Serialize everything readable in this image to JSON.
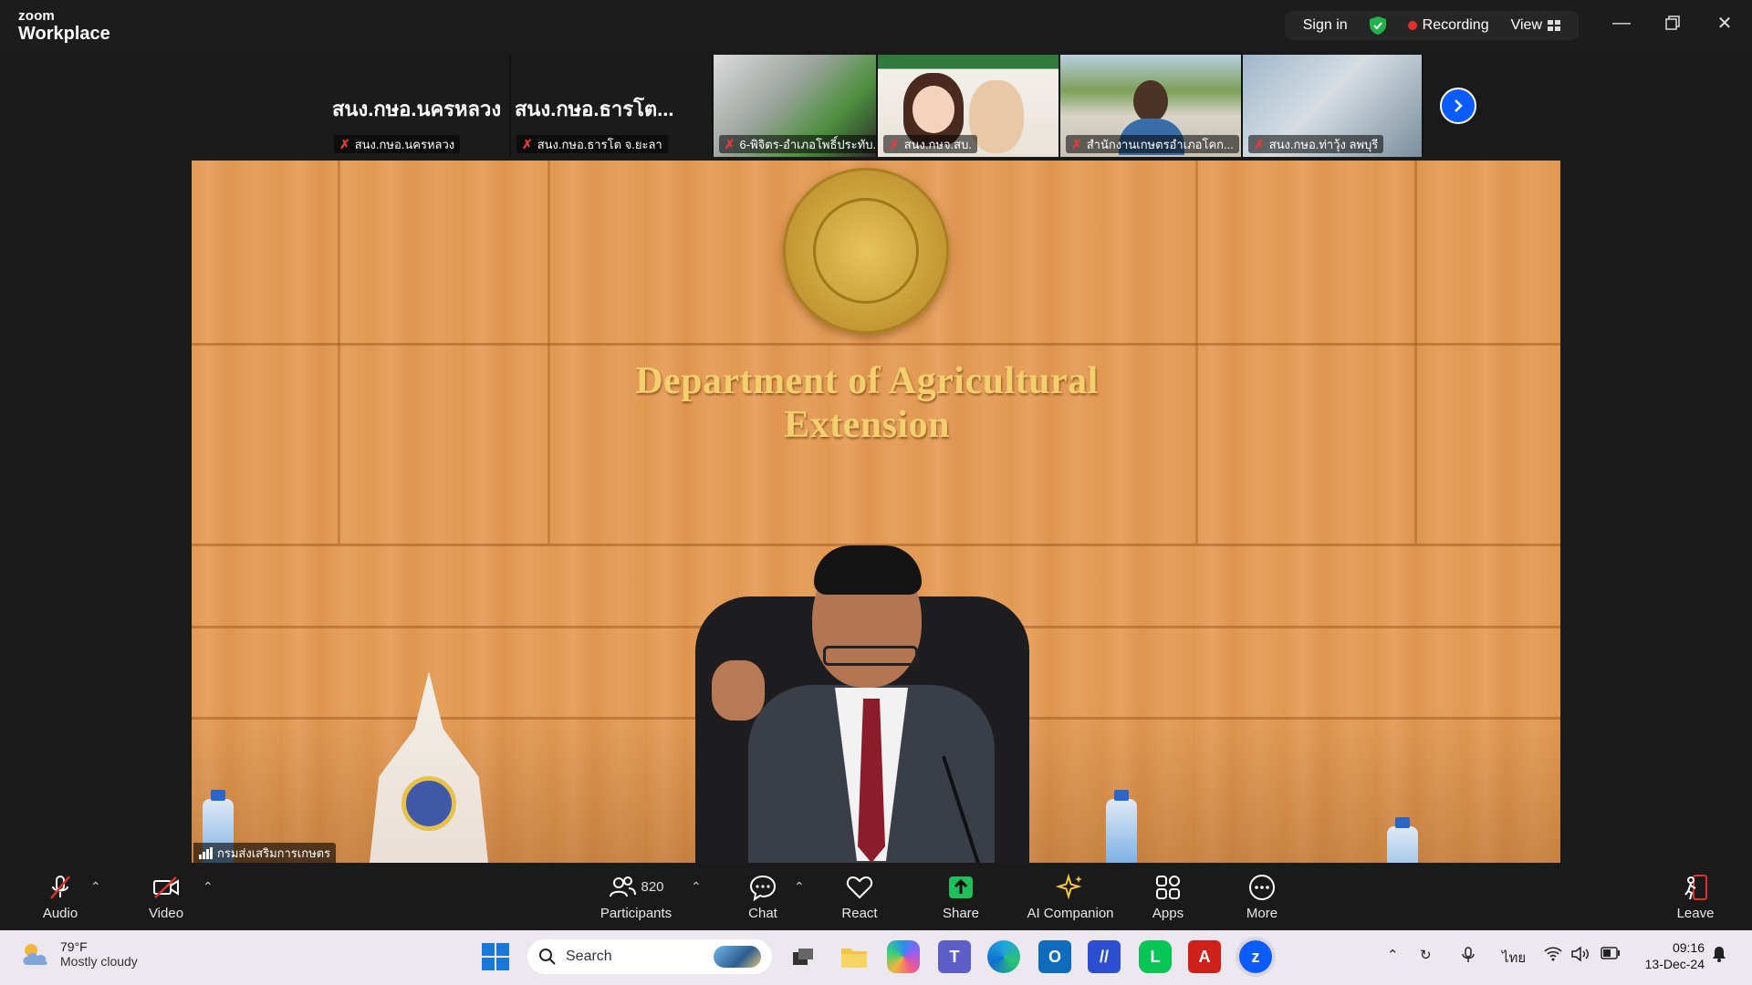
{
  "titlebar": {
    "brand": "zoom",
    "product": "Workplace",
    "sign_in": "Sign in",
    "recording": "Recording",
    "view": "View",
    "colors": {
      "recording_dot": "#e0312b",
      "shield": "#21b24b"
    }
  },
  "thumbnails": [
    {
      "big_name": "สนง.กษอ.นครหลวง",
      "label": "สนง.กษอ.นครหลวง",
      "muted": true
    },
    {
      "big_name": "สนง.กษอ.ธารโต...",
      "label": "สนง.กษอ.ธารโต จ.ยะลา",
      "muted": true
    },
    {
      "big_name": "",
      "label": "6-พิจิตร-อำเภอโพธิ์ประทับ...",
      "muted": true
    },
    {
      "big_name": "",
      "label": "สนง.กษจ.สบ.",
      "muted": true
    },
    {
      "big_name": "",
      "label": "สำนักงานเกษตรอำเภอโคก...",
      "muted": true
    },
    {
      "big_name": "",
      "label": "สนง.กษอ.ท่าวุ้ง ลพบุรี",
      "muted": true
    }
  ],
  "main_video": {
    "sign_text": "Department of Agricultural Extension",
    "speaker_name": "กรมส่งเสริมการเกษตร"
  },
  "toolbar": {
    "audio": "Audio",
    "video": "Video",
    "participants": "Participants",
    "participants_count": "820",
    "chat": "Chat",
    "react": "React",
    "share": "Share",
    "ai_companion": "AI Companion",
    "apps": "Apps",
    "more": "More",
    "leave": "Leave",
    "colors": {
      "share": "#1fbf5a",
      "ai": "#f5c842",
      "leave": "#e0312b"
    }
  },
  "taskbar": {
    "temperature": "79°F",
    "condition": "Mostly cloudy",
    "search_placeholder": "Search",
    "language": "ไทย",
    "time": "09:16",
    "date": "13-Dec-24"
  }
}
